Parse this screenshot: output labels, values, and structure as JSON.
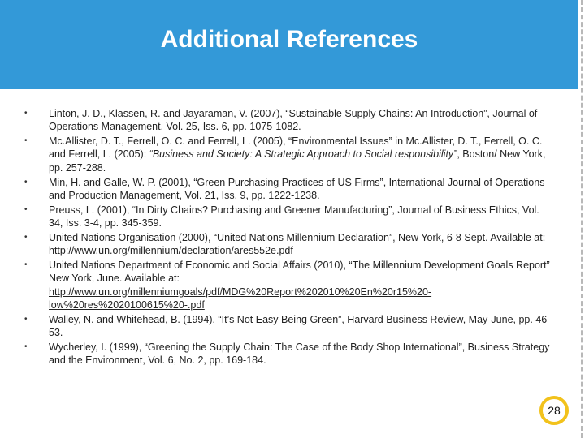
{
  "slide": {
    "title": "Additional References",
    "page_number": "28",
    "colors": {
      "header": "#3399d8",
      "badge_ring": "#f2c21b"
    },
    "references": [
      {
        "text": "Linton, J. D., Klassen, R. and Jayaraman, V. (2007), “Sustainable Supply Chains: An Introduction”, Journal of Operations Management, Vol. 25, Iss. 6, pp. 1075-1082."
      },
      {
        "pre": "Mc.Allister, D. T., Ferrell, O. C. and Ferrell, L. (2005), “Environmental Issues” in Mc.Allister, D. T., Ferrell, O. C. and Ferrell, L. (2005): ",
        "italic": "“Business and Society: A Strategic Approach to Social responsibility”",
        "post": ", Boston/ New York, pp. 257-288."
      },
      {
        "text": "Min, H. and Galle, W. P. (2001), “Green Purchasing Practices of US Firms”, International Journal of Operations and Production Management, Vol. 21, Iss, 9, pp. 1222-1238."
      },
      {
        "text": "Preuss, L. (2001), “In Dirty Chains? Purchasing and Greener Manufacturing”, Journal of Business Ethics, Vol. 34, Iss. 3-4, pp. 345-359."
      },
      {
        "pre": "United Nations Organisation (2000), “United Nations Millennium Declaration”,  New York, 6-8 Sept. Available at: ",
        "link": "http://www.un.org/millennium/declaration/ares552e.pdf"
      },
      {
        "pre": "United Nations Department of Economic and Social Affairs (2010), “The Millennium Development Goals Report” New York, June. Available at: ",
        "link": "http://www.un.org/millenniumgoals/pdf/MDG%20Report%202010%20En%20r15%20-low%20res%2020100615%20-.pdf"
      },
      {
        "text": "Walley, N. and Whitehead, B. (1994), “It’s Not Easy Being Green”, Harvard Business Review, May-June, pp. 46-53."
      },
      {
        "text": "Wycherley, I. (1999), “Greening the Supply Chain: The Case of the Body Shop International”, Business Strategy and the Environment, Vol. 6, No. 2, pp. 169-184."
      }
    ]
  }
}
